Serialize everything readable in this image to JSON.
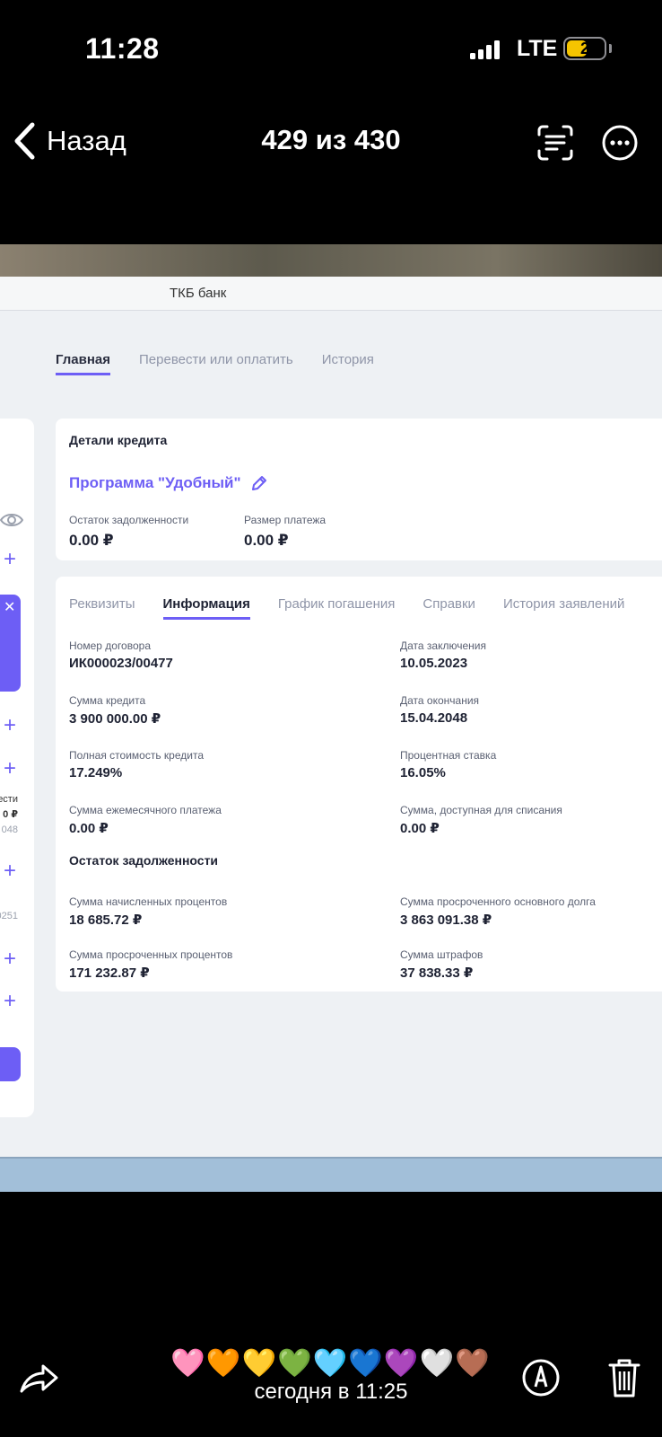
{
  "status_bar": {
    "time": "11:28",
    "network": "LTE",
    "battery": "2"
  },
  "nav": {
    "back_label": "Назад",
    "title": "429 из 430"
  },
  "screenshot": {
    "bank_title": "ТКБ банк",
    "top_tabs": [
      {
        "label": "Главная",
        "active": true
      },
      {
        "label": "Перевести или оплатить",
        "active": false
      },
      {
        "label": "История",
        "active": false
      }
    ],
    "left_panel": {
      "text_1": "ести",
      "text_2": "0 ₽",
      "text_3": "048",
      "text_4": "0251"
    },
    "credit_details": {
      "heading": "Детали кредита",
      "program": "Программа \"Удобный\"",
      "debt_label": "Остаток задолженности",
      "debt_value": "0.00 ₽",
      "payment_label": "Размер платежа",
      "payment_value": "0.00 ₽"
    },
    "sub_tabs": [
      {
        "label": "Реквизиты",
        "active": false
      },
      {
        "label": "Информация",
        "active": true
      },
      {
        "label": "График погашения",
        "active": false
      },
      {
        "label": "Справки",
        "active": false
      },
      {
        "label": "История заявлений",
        "active": false
      }
    ],
    "info": {
      "contract_label": "Номер договора",
      "contract_value": "ИК000023/00477",
      "date_signed_label": "Дата заключения",
      "date_signed_value": "10.05.2023",
      "amount_label": "Сумма кредита",
      "amount_value": "3 900 000.00 ₽",
      "date_end_label": "Дата окончания",
      "date_end_value": "15.04.2048",
      "full_cost_label": "Полная стоимость кредита",
      "full_cost_value": "17.249%",
      "rate_label": "Процентная ставка",
      "rate_value": "16.05%",
      "monthly_label": "Сумма ежемесячного платежа",
      "monthly_value": "0.00 ₽",
      "available_label": "Сумма, доступная для списания",
      "available_value": "0.00 ₽"
    },
    "debt": {
      "heading": "Остаток задолженности",
      "accrued_label": "Сумма начисленных процентов",
      "accrued_value": "18 685.72 ₽",
      "overdue_principal_label": "Сумма просроченного основного долга",
      "overdue_principal_value": "3 863 091.38 ₽",
      "overdue_interest_label": "Сумма просроченных процентов",
      "overdue_interest_value": "171 232.87 ₽",
      "fines_label": "Сумма штрафов",
      "fines_value": "37 838.33 ₽"
    }
  },
  "bottom": {
    "reactions": [
      "🩷",
      "🧡",
      "💛",
      "💚",
      "🩵",
      "💙",
      "💜",
      "🤍",
      "🤎"
    ],
    "timestamp": "сегодня в 11:25"
  },
  "colors": {
    "accent": "#6d5ef5",
    "background": "#000000"
  }
}
